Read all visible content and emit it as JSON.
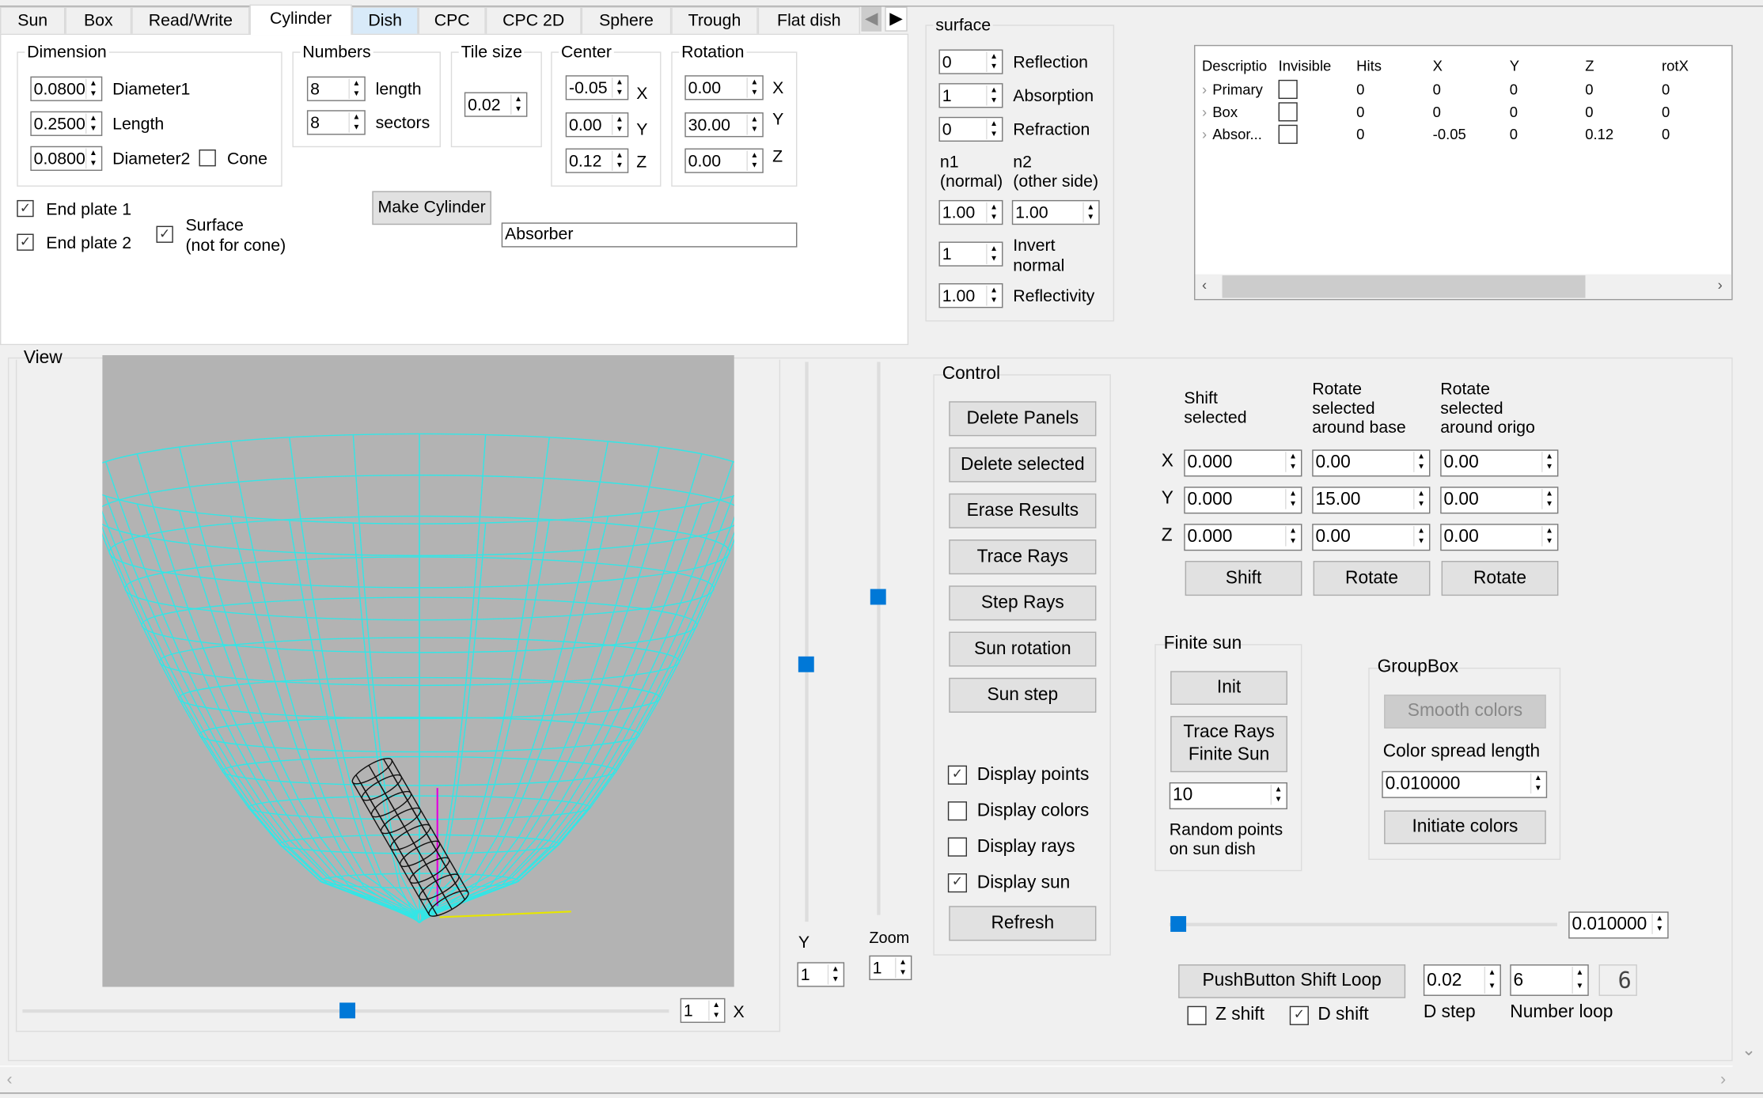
{
  "tabs": [
    "Sun",
    "Box",
    "Read/Write",
    "Cylinder",
    "Dish",
    "CPC",
    "CPC 2D",
    "Sphere",
    "Trough",
    "Flat dish"
  ],
  "active_tab": "Cylinder",
  "cylinder": {
    "dimension": {
      "title": "Dimension",
      "diameter1": "0.0800",
      "diameter1_label": "Diameter1",
      "length": "0.2500",
      "length_label": "Length",
      "diameter2": "0.0800",
      "diameter2_label": "Diameter2",
      "cone_label": "Cone",
      "cone_checked": false
    },
    "numbers": {
      "title": "Numbers",
      "length": "8",
      "length_label": "length",
      "sectors": "8",
      "sectors_label": "sectors"
    },
    "tile": {
      "title": "Tile size",
      "value": "0.02"
    },
    "center": {
      "title": "Center",
      "x": "-0.05",
      "y": "0.00",
      "z": "0.12",
      "xl": "X",
      "yl": "Y",
      "zl": "Z"
    },
    "rotation": {
      "title": "Rotation",
      "x": "0.00",
      "y": "30.00",
      "z": "0.00",
      "xl": "X",
      "yl": "Y",
      "zl": "Z"
    },
    "end_plate1": "End plate 1",
    "end_plate2": "End plate 2",
    "surface_l1": "Surface",
    "surface_l2": "(not for cone)",
    "make_button": "Make Cylinder",
    "name_value": "Absorber"
  },
  "surface": {
    "title": "surface",
    "reflection": "0",
    "reflection_label": "Reflection",
    "absorption": "1",
    "absorption_label": "Absorption",
    "refraction": "0",
    "refraction_label": "Refraction",
    "n1_l1": "n1",
    "n1_l2": "(normal)",
    "n2_l1": "n2",
    "n2_l2": "(other side)",
    "n1": "1.00",
    "n2": "1.00",
    "invert": "1",
    "invert_l1": "Invert",
    "invert_l2": "normal",
    "reflectivity": "1.00",
    "reflectivity_label": "Reflectivity"
  },
  "table": {
    "columns": [
      "Descriptio",
      "Invisible",
      "Hits",
      "X",
      "Y",
      "Z",
      "rotX"
    ],
    "rows": [
      [
        "Primary",
        "",
        "0",
        "0",
        "0",
        "0",
        "0"
      ],
      [
        "Box",
        "",
        "0",
        "0",
        "0",
        "0",
        "0"
      ],
      [
        "Absor...",
        "",
        "0",
        "-0.05",
        "0",
        "0.12",
        "0"
      ]
    ]
  },
  "view": {
    "title": "View",
    "x_value": "1",
    "x_label": "X",
    "y_value": "1",
    "y_label": "Y",
    "zoom_value": "1",
    "zoom_label": "Zoom",
    "bg": "#b3b3b3",
    "mesh_color": "#33e6e6"
  },
  "control": {
    "title": "Control",
    "buttons": [
      "Delete Panels",
      "Delete selected",
      "Erase Results",
      "Trace Rays",
      "Step Rays",
      "Sun rotation",
      "Sun step",
      "Refresh"
    ],
    "checks": [
      {
        "label": "Display points",
        "checked": true
      },
      {
        "label": "Display colors",
        "checked": false
      },
      {
        "label": "Display rays",
        "checked": false
      },
      {
        "label": "Display sun",
        "checked": true
      }
    ]
  },
  "transform": {
    "shift_header": "Shift\nselected",
    "rot_base_header": "Rotate\nselected\naround base",
    "rot_origo_header": "Rotate\nselected\naround origo",
    "rows": [
      {
        "axis": "X",
        "shift": "0.000",
        "base": "0.00",
        "origo": "0.00"
      },
      {
        "axis": "Y",
        "shift": "0.000",
        "base": "15.00",
        "origo": "0.00"
      },
      {
        "axis": "Z",
        "shift": "0.000",
        "base": "0.00",
        "origo": "0.00"
      }
    ],
    "shift_button": "Shift",
    "rotate_button": "Rotate",
    "rotate2_button": "Rotate"
  },
  "finite_sun": {
    "title": "Finite sun",
    "init": "Init",
    "trace": "Trace Rays\nFinite Sun",
    "points": "10",
    "points_label": "Random points\non sun dish"
  },
  "groupbox": {
    "title": "GroupBox",
    "smooth": "Smooth colors",
    "spread_label": "Color spread length",
    "spread": "0.010000",
    "initiate": "Initiate colors"
  },
  "bottom": {
    "slider_value": "0.010000",
    "loop_button": "PushButton Shift Loop",
    "z_shift": "Z shift",
    "z_checked": false,
    "d_shift": "D shift",
    "d_checked": true,
    "d_step": "0.02",
    "d_step_label": "D step",
    "number_loop": "6",
    "number_loop_label": "Number loop",
    "lcd": "6"
  },
  "check_glyph": "✓"
}
